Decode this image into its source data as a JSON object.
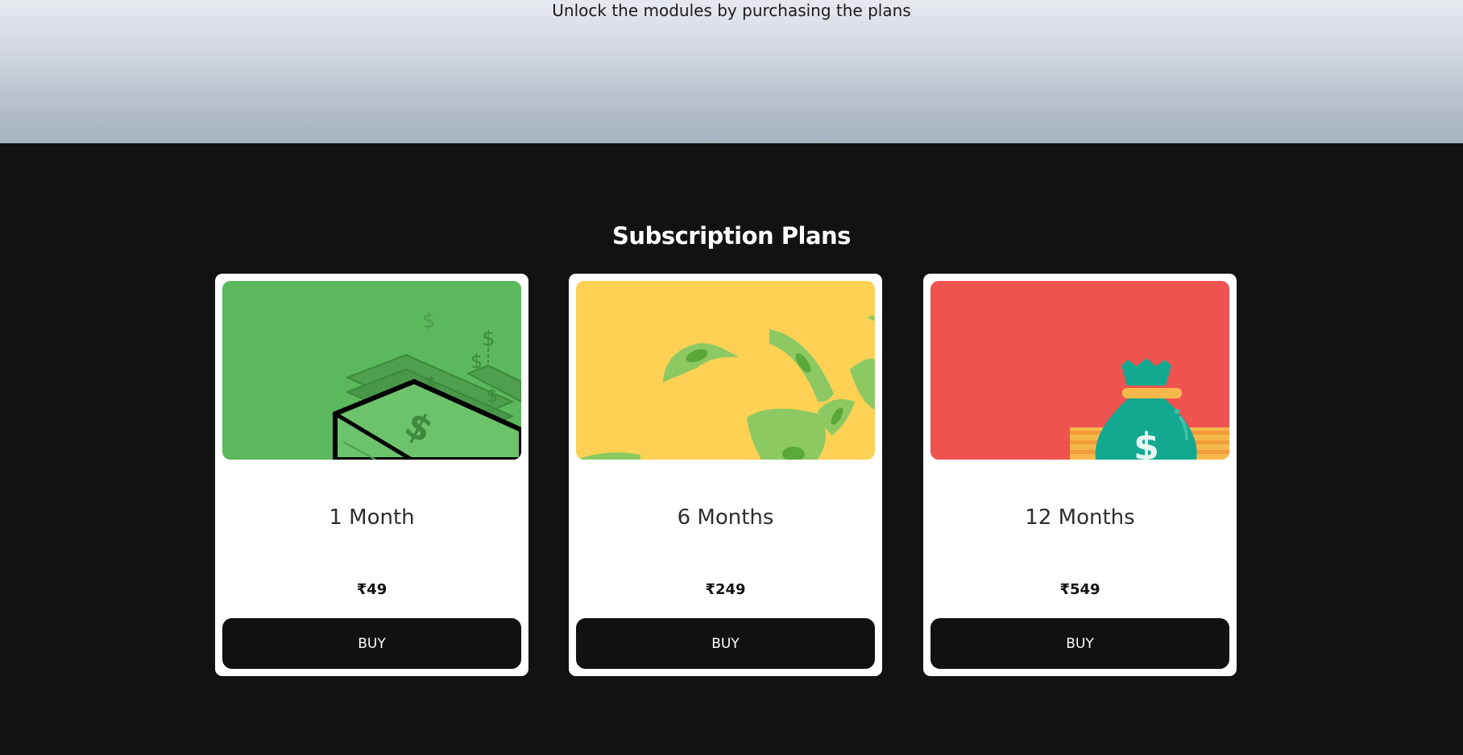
{
  "hero": {
    "subtitle": "Unlock the modules by purchasing the plans"
  },
  "plans_section": {
    "title": "Subscription Plans",
    "plans": [
      {
        "name": "1 Month",
        "price": "₹49",
        "button": "BUY",
        "image": "money-stack-illustration",
        "image_color": "#5cb85c"
      },
      {
        "name": "6 Months",
        "price": "₹249",
        "button": "BUY",
        "image": "flying-money-illustration",
        "image_color": "#fed154"
      },
      {
        "name": "12 Months",
        "price": "₹549",
        "button": "BUY",
        "image": "money-bag-illustration",
        "image_color": "#ef5350"
      }
    ]
  },
  "colors": {
    "page_background": "#121212",
    "card_background": "#ffffff",
    "button_background": "#111111",
    "button_text": "#ffffff"
  }
}
